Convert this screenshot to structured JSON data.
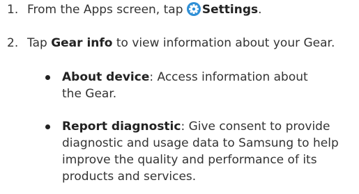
{
  "steps": [
    {
      "number": "1.",
      "prefix": "From the Apps screen, tap",
      "icon": "settings-gear-icon",
      "bold": "Settings",
      "suffix": "."
    },
    {
      "number": "2.",
      "prefix": "Tap",
      "bold": "Gear info",
      "suffix": "to view information about your Gear."
    }
  ],
  "bullets": [
    {
      "term": "About device",
      "line1": ": Access information about",
      "line2": "the Gear."
    },
    {
      "term": "Report diagnostic",
      "line1": ": Give consent to provide",
      "line2": "diagnostic and usage data to Samsung to help",
      "line3": "improve the quality and performance of its",
      "line4": "products and services."
    }
  ],
  "colors": {
    "icon_blue": "#2f8fd6",
    "text": "#333333"
  }
}
